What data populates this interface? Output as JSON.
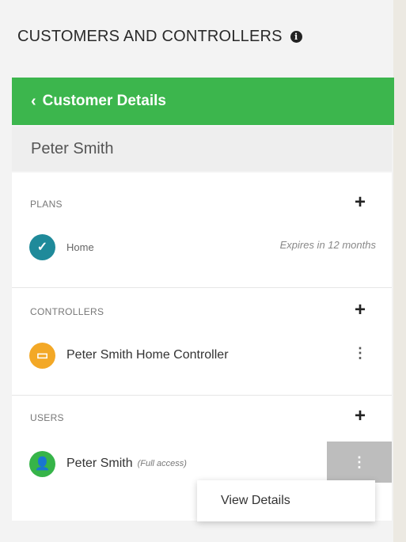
{
  "page": {
    "title": "CUSTOMERS AND CONTROLLERS"
  },
  "header": {
    "back_label": "Customer Details",
    "accent": "#3cb64d"
  },
  "customer": {
    "name": "Peter Smith"
  },
  "plans": {
    "label": "PLANS",
    "items": [
      {
        "name": "Home",
        "expires": "Expires in 12 months",
        "icon": "check-icon"
      }
    ]
  },
  "controllers": {
    "label": "CONTROLLERS",
    "items": [
      {
        "name": "Peter Smith Home Controller",
        "icon": "controller-icon"
      }
    ]
  },
  "users": {
    "label": "USERS",
    "items": [
      {
        "name": "Peter Smith",
        "access": "(Full access)",
        "icon": "user-icon"
      }
    ]
  },
  "menu": {
    "items": [
      {
        "label": "View Details"
      }
    ]
  }
}
